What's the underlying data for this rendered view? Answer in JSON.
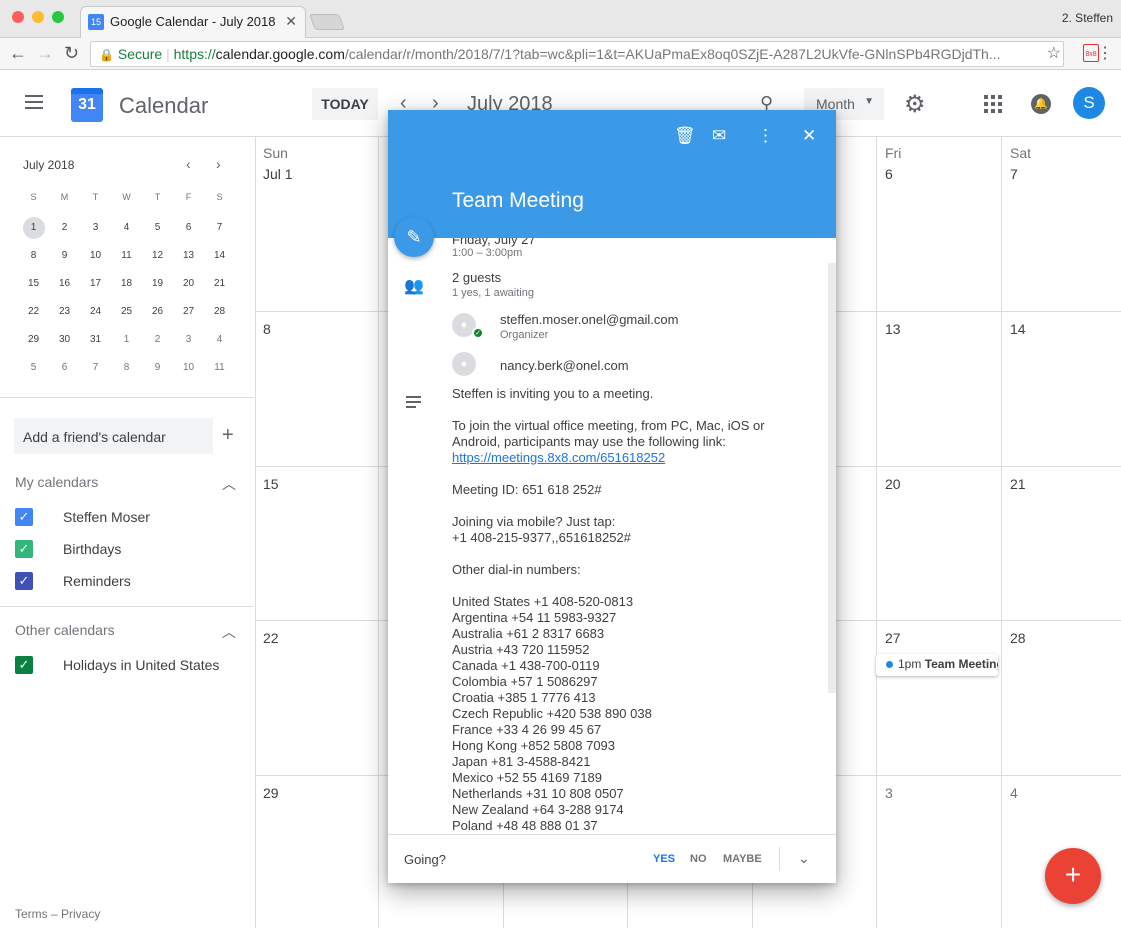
{
  "browser": {
    "tab_title": "Google Calendar - July 2018",
    "favicon_text": "15",
    "profile": "2. Steffen",
    "secure_label": "Secure",
    "url_scheme": "https://",
    "url_domain": "calendar.google.com",
    "url_rest": "/calendar/r/month/2018/7/1?tab=wc&pli=1&t=AKUaPmaEx8oq0SZjE-A287L2UkVfe-GNlnSPb4RGDjdTh...",
    "ext_label": "8x8"
  },
  "header": {
    "app_name": "Calendar",
    "logo_day": "31",
    "today_label": "TODAY",
    "month_label": "July 2018",
    "view_label": "Month",
    "avatar_initial": "S"
  },
  "mini_calendar": {
    "title": "July 2018",
    "weekdays": [
      "S",
      "M",
      "T",
      "W",
      "T",
      "F",
      "S"
    ],
    "weeks": [
      [
        "1",
        "2",
        "3",
        "4",
        "5",
        "6",
        "7"
      ],
      [
        "8",
        "9",
        "10",
        "11",
        "12",
        "13",
        "14"
      ],
      [
        "15",
        "16",
        "17",
        "18",
        "19",
        "20",
        "21"
      ],
      [
        "22",
        "23",
        "24",
        "25",
        "26",
        "27",
        "28"
      ],
      [
        "29",
        "30",
        "31",
        "1",
        "2",
        "3",
        "4"
      ],
      [
        "5",
        "6",
        "7",
        "8",
        "9",
        "10",
        "11"
      ]
    ]
  },
  "sidebar": {
    "add_friend_label": "Add a friend's calendar",
    "my_calendars_label": "My calendars",
    "my_calendars": [
      {
        "name": "Steffen Moser",
        "color": "#4285f4"
      },
      {
        "name": "Birthdays",
        "color": "#33b679"
      },
      {
        "name": "Reminders",
        "color": "#3f51b5"
      }
    ],
    "other_calendars_label": "Other calendars",
    "other_calendars": [
      {
        "name": "Holidays in United States",
        "color": "#0b8043"
      }
    ],
    "terms": "Terms",
    "privacy": "Privacy"
  },
  "month_grid": {
    "sun_label": "Sun",
    "fri_label": "Fri",
    "sat_label": "Sat",
    "sun_days": [
      "Jul 1",
      "8",
      "15",
      "22",
      "29"
    ],
    "fri_days": [
      "6",
      "13",
      "20",
      "27",
      "3"
    ],
    "sat_days": [
      "7",
      "14",
      "21",
      "28",
      "4"
    ],
    "event_time": "1pm",
    "event_title": "Team Meeting"
  },
  "event_dialog": {
    "title": "Team Meeting",
    "date": "Friday, July 27",
    "time": "1:00 – 3:00pm",
    "guests_count": "2 guests",
    "guests_status": "1 yes, 1 awaiting",
    "guests": [
      {
        "email": "steffen.moser.onel@gmail.com",
        "role": "Organizer"
      },
      {
        "email": "nancy.berk@onel.com",
        "role": ""
      }
    ],
    "description": {
      "intro": "Steffen is inviting you to a meeting.",
      "join_text": "To join the virtual office meeting, from PC, Mac, iOS or Android, participants may use the following link:",
      "link": "https://meetings.8x8.com/651618252",
      "meeting_id": "Meeting ID: 651 618 252#",
      "mobile_label": "Joining via mobile? Just tap:",
      "mobile_number": "+1 408-215-9377,,651618252#",
      "other_label": "Other dial-in numbers:",
      "numbers": [
        "United States +1 408-520-0813",
        "Argentina +54 11 5983-9327",
        "Australia +61 2 8317 6683",
        "Austria +43 720 115952",
        "Canada +1 438-700-0119",
        "Colombia +57 1 5086297",
        "Croatia +385 1 7776 413",
        "Czech Republic +420 538 890 038",
        "France +33 4 26 99 45 67",
        "Hong Kong +852 5808 7093",
        "Japan +81 3-4588-8421",
        "Mexico +52 55 4169 7189",
        "Netherlands +31 10 808 0507",
        "New Zealand +64 3-288 9174",
        "Poland +48 48 888 01 37"
      ]
    },
    "going_label": "Going?",
    "yes_label": "YES",
    "no_label": "NO",
    "maybe_label": "MAYBE"
  }
}
